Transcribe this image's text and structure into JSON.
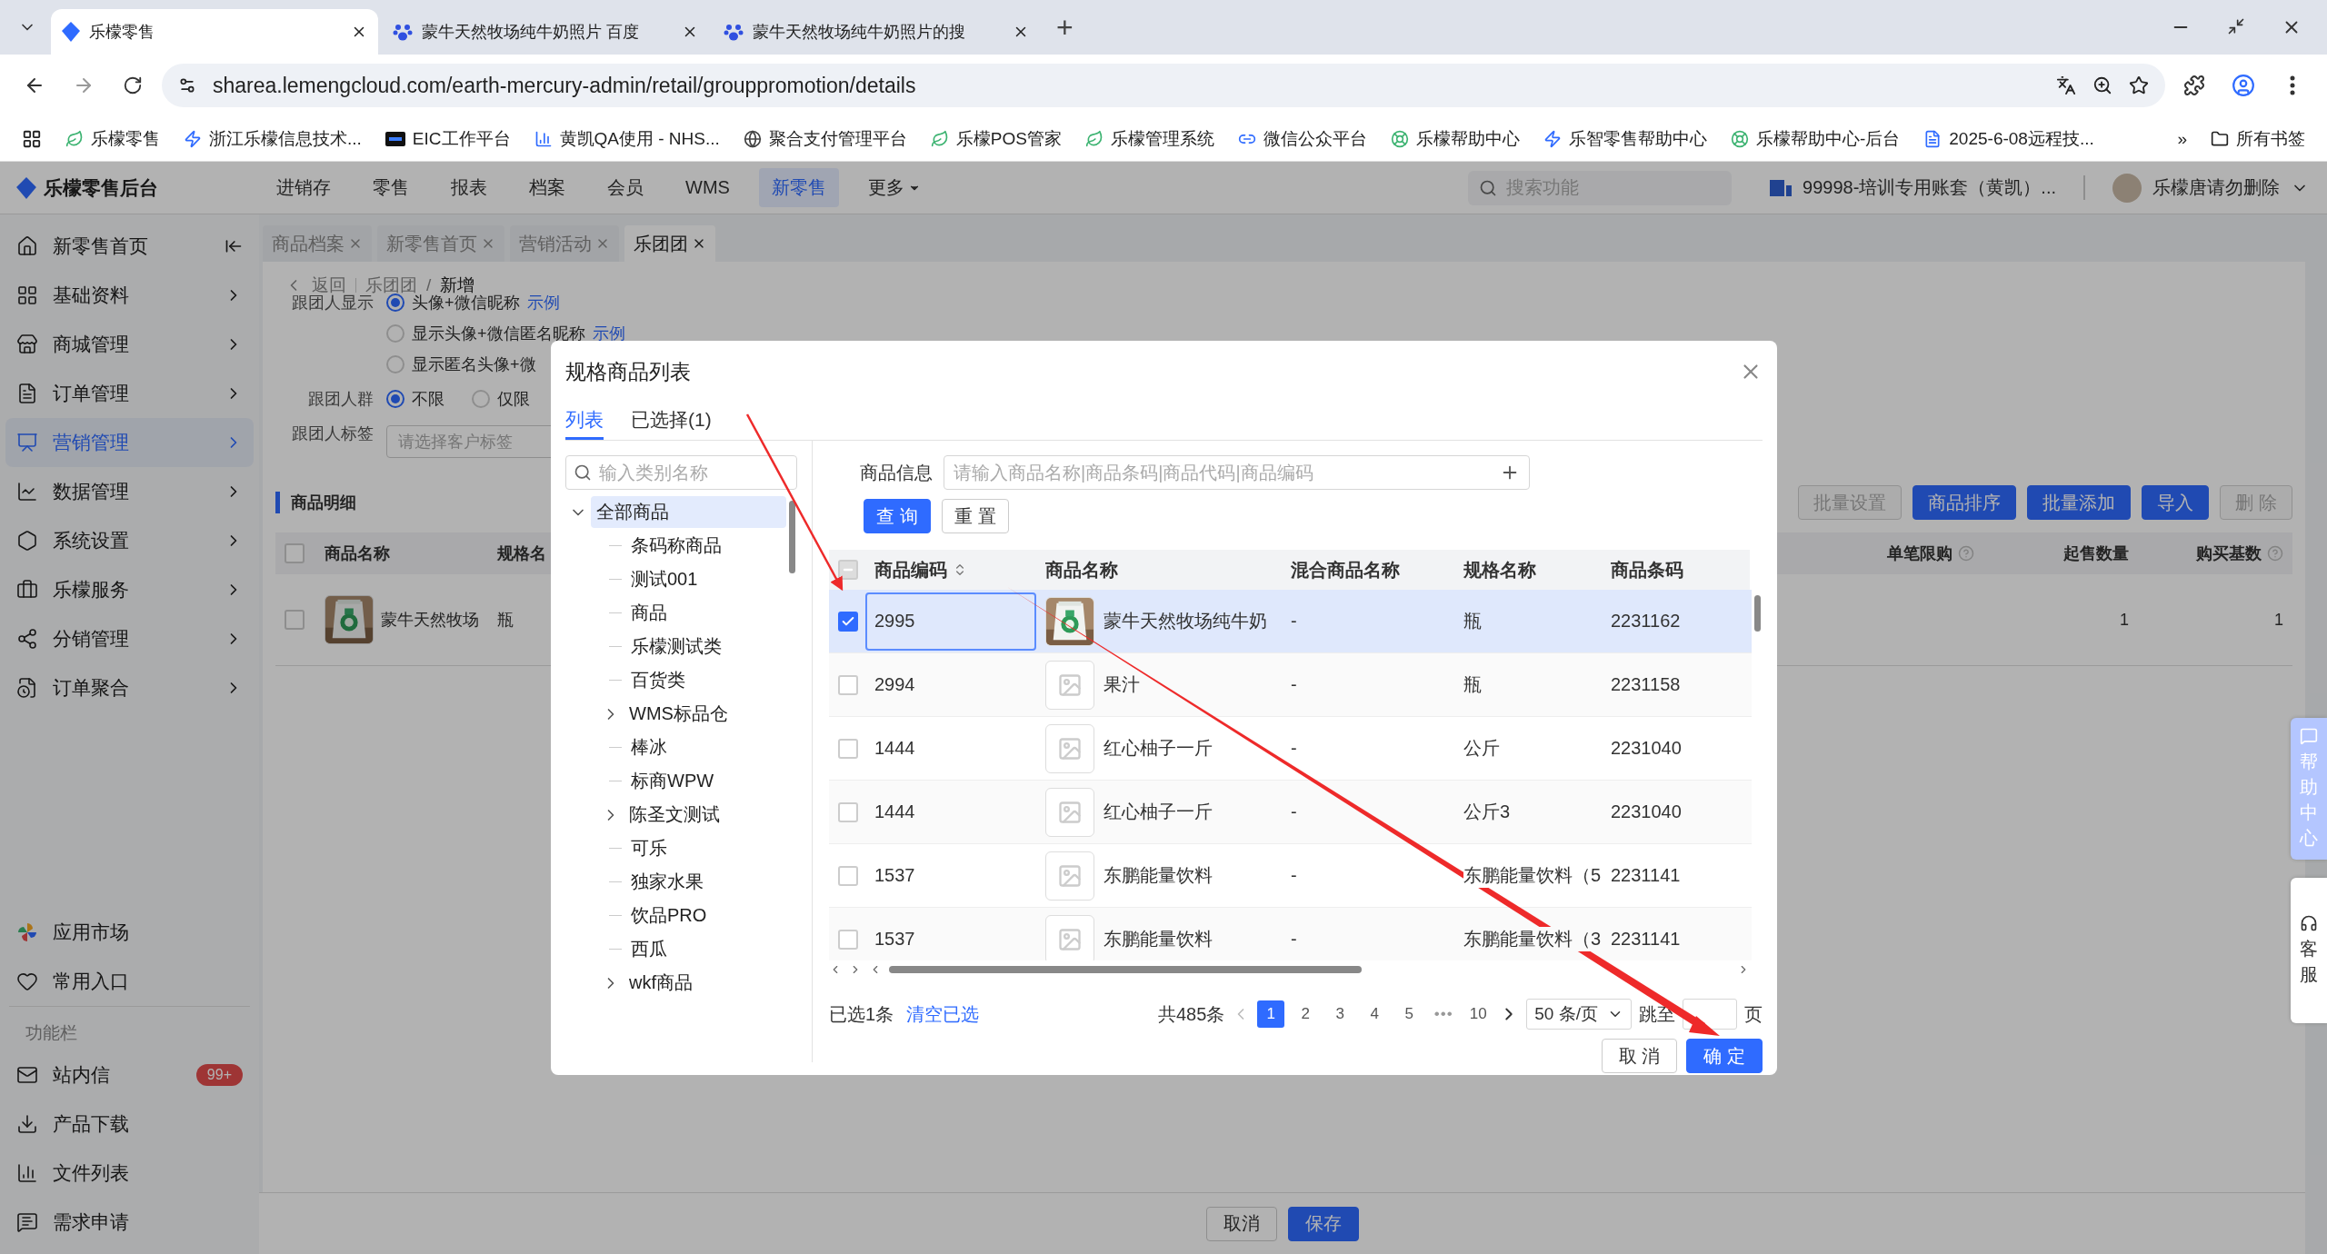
{
  "browser": {
    "tabs": [
      {
        "title": "乐檬零售",
        "selected": true
      },
      {
        "title": "蒙牛天然牧场纯牛奶照片 百度",
        "selected": false
      },
      {
        "title": "蒙牛天然牧场纯牛奶照片的搜",
        "selected": false
      }
    ],
    "new_tab": "+",
    "url": "sharea.lemengcloud.com/earth-mercury-admin/retail/grouppromotion/details",
    "bookmarks": [
      "乐檬零售",
      "浙江乐檬信息技术...",
      "EIC工作平台",
      "黄凯QA使用 - NHS...",
      "聚合支付管理平台",
      "乐檬POS管家",
      "乐檬管理系统",
      "微信公众平台",
      "乐檬帮助中心",
      "乐智零售帮助中心",
      "乐檬帮助中心-后台",
      "2025-6-08远程技..."
    ],
    "more": "»",
    "all_bookmarks": "所有书签"
  },
  "app": {
    "logo": "乐檬零售后台",
    "nav": [
      {
        "label": "进销存",
        "selected": false,
        "dropdown": false
      },
      {
        "label": "零售",
        "selected": false,
        "dropdown": false
      },
      {
        "label": "报表",
        "selected": false,
        "dropdown": false
      },
      {
        "label": "档案",
        "selected": false,
        "dropdown": false
      },
      {
        "label": "会员",
        "selected": false,
        "dropdown": false
      },
      {
        "label": "WMS",
        "selected": false,
        "dropdown": false
      },
      {
        "label": "新零售",
        "selected": true,
        "dropdown": false
      },
      {
        "label": "更多",
        "selected": false,
        "dropdown": true
      }
    ],
    "search_placeholder": "搜索功能",
    "account": "99998-培训专用账套（黄凯）...",
    "user": "乐檬唐请勿删除"
  },
  "sidebar": {
    "items": [
      {
        "label": "新零售首页",
        "selected": false
      },
      {
        "label": "基础资料",
        "selected": false
      },
      {
        "label": "商城管理",
        "selected": false
      },
      {
        "label": "订单管理",
        "selected": false
      },
      {
        "label": "营销管理",
        "selected": true
      },
      {
        "label": "数据管理",
        "selected": false
      },
      {
        "label": "系统设置",
        "selected": false
      },
      {
        "label": "乐檬服务",
        "selected": false
      },
      {
        "label": "分销管理",
        "selected": false
      },
      {
        "label": "订单聚合",
        "selected": false
      }
    ],
    "shortcuts": [
      "应用市场",
      "常用入口"
    ],
    "section_label": "功能栏",
    "tools": [
      {
        "label": "站内信",
        "badge": "99+"
      },
      {
        "label": "产品下载"
      },
      {
        "label": "文件列表"
      },
      {
        "label": "需求申请"
      }
    ]
  },
  "page_tabs": [
    {
      "label": "商品档案",
      "selected": false
    },
    {
      "label": "新零售首页",
      "selected": false
    },
    {
      "label": "营销活动",
      "selected": false
    },
    {
      "label": "乐团团",
      "selected": true
    }
  ],
  "breadcrumb": {
    "back": "返回",
    "parent": "乐团团",
    "separator": "/",
    "current": "新增"
  },
  "form": [
    {
      "label": "跟团人显示",
      "kind": "radios",
      "options": [
        {
          "text": "头像+微信昵称",
          "selected": true,
          "link": "示例"
        },
        {
          "text": "显示头像+微信匿名昵称",
          "selected": false,
          "link": "示例"
        },
        {
          "text": "显示匿名头像+微",
          "selected": false
        }
      ]
    },
    {
      "label": "跟团人群",
      "kind": "radios",
      "options": [
        {
          "text": "不限",
          "selected": true
        },
        {
          "text": "仅限",
          "selected": false
        }
      ]
    },
    {
      "label": "跟团人标签",
      "kind": "select",
      "placeholder": "请选择客户标签"
    }
  ],
  "detail": {
    "title": "商品明细",
    "buttons": [
      {
        "label": "批量设置",
        "disabled": true
      },
      {
        "label": "商品排序",
        "disabled": false
      },
      {
        "label": "批量添加",
        "disabled": false
      },
      {
        "label": "导入",
        "disabled": false
      },
      {
        "label": "删 除",
        "disabled": true
      }
    ],
    "header_checked": false,
    "columns_left": [
      "商品名称",
      "规格名"
    ],
    "columns_right": [
      {
        "label": "单笔限购",
        "help": true
      },
      {
        "label": "起售数量",
        "help": false
      },
      {
        "label": "购买基数",
        "help": true
      }
    ],
    "rows": [
      {
        "checked": false,
        "name": "蒙牛天然牧场",
        "spec": "瓶",
        "min_qty": "1",
        "base": "1"
      }
    ]
  },
  "footer_buttons": [
    {
      "label": "取消",
      "primary": false
    },
    {
      "label": "保存",
      "primary": true
    }
  ],
  "side_widgets": [
    {
      "label": "帮助中心",
      "kind": "help"
    },
    {
      "label": "客服",
      "kind": "service"
    }
  ],
  "modal": {
    "title": "规格商品列表",
    "tabs": [
      {
        "label": "列表",
        "selected": true
      },
      {
        "label": "已选择(1)",
        "selected": false
      }
    ],
    "category_search": "输入类别名称",
    "tree": [
      {
        "label": "全部商品",
        "selected": true,
        "expanded": true,
        "children": [
          {
            "label": "条码称商品",
            "selected": false
          },
          {
            "label": "测试001",
            "selected": false
          },
          {
            "label": "商品",
            "selected": false
          },
          {
            "label": "乐檬测试类",
            "selected": false
          },
          {
            "label": "百货类",
            "selected": false
          },
          {
            "label": "WMS标品仓",
            "selected": false,
            "expanded": false
          },
          {
            "label": "棒冰",
            "selected": false
          },
          {
            "label": "标商WPW",
            "selected": false
          },
          {
            "label": "陈圣文测试",
            "selected": false,
            "expanded": false
          },
          {
            "label": "可乐",
            "selected": false
          },
          {
            "label": "独家水果",
            "selected": false
          },
          {
            "label": "饮品PRO",
            "selected": false
          },
          {
            "label": "西瓜",
            "selected": false
          },
          {
            "label": "wkf商品",
            "selected": false,
            "expanded": false
          }
        ]
      }
    ],
    "filter_label": "商品信息",
    "filter_placeholder": "请输入商品名称|商品条码|商品代码|商品编码",
    "query": "查 询",
    "reset": "重 置",
    "header_checkbox": {
      "checked": false,
      "indeterminate": true
    },
    "columns": [
      {
        "label": "商品编码",
        "sortable": true
      },
      {
        "label": "商品名称",
        "sortable": false
      },
      {
        "label": "混合商品名称",
        "sortable": false
      },
      {
        "label": "规格名称",
        "sortable": false
      },
      {
        "label": "商品条码",
        "sortable": false
      }
    ],
    "rows": [
      {
        "code": "2995",
        "name": "蒙牛天然牧场纯牛奶",
        "mixed": "-",
        "spec": "瓶",
        "barcode": "2231162",
        "checked": true,
        "selected": true
      },
      {
        "kind": "placeholder",
        "code": "2994",
        "name": "果汁",
        "mixed": "-",
        "spec": "瓶",
        "barcode": "2231158",
        "checked": false,
        "selected": false
      },
      {
        "kind": "placeholder",
        "code": "1444",
        "name": "红心柚子一斤",
        "mixed": "-",
        "spec": "公斤",
        "barcode": "2231040",
        "checked": false,
        "selected": false
      },
      {
        "kind": "placeholder",
        "code": "1444",
        "name": "红心柚子一斤",
        "mixed": "-",
        "spec": "公斤3",
        "barcode": "2231040",
        "checked": false,
        "selected": false
      },
      {
        "kind": "placeholder",
        "code": "1537",
        "name": "东鹏能量饮料",
        "mixed": "-",
        "spec": "东鹏能量饮料（5",
        "barcode": "2231141",
        "checked": false,
        "selected": false
      },
      {
        "kind": "placeholder",
        "code": "1537",
        "name": "东鹏能量饮料",
        "mixed": "-",
        "spec": "东鹏能量饮料（3",
        "barcode": "2231141",
        "checked": false,
        "selected": false
      }
    ],
    "selected_count": "已选1条",
    "clear": "清空已选",
    "total": "共485条",
    "prev_disabled": true,
    "next_disabled": false,
    "pages": [
      {
        "label": "1",
        "kind": "page",
        "selected": true
      },
      {
        "label": "2",
        "kind": "page",
        "selected": false
      },
      {
        "label": "3",
        "kind": "page",
        "selected": false
      },
      {
        "label": "4",
        "kind": "page",
        "selected": false
      },
      {
        "label": "5",
        "kind": "page",
        "selected": false
      },
      {
        "label": "•••",
        "kind": "ellipsis",
        "selected": false
      },
      {
        "label": "10",
        "kind": "page",
        "selected": false
      }
    ],
    "page_size": "50 条/页",
    "jump": "跳至",
    "jump_suffix": "页",
    "buttons": [
      {
        "label": "取 消",
        "primary": false
      },
      {
        "label": "确 定",
        "primary": true
      }
    ]
  }
}
